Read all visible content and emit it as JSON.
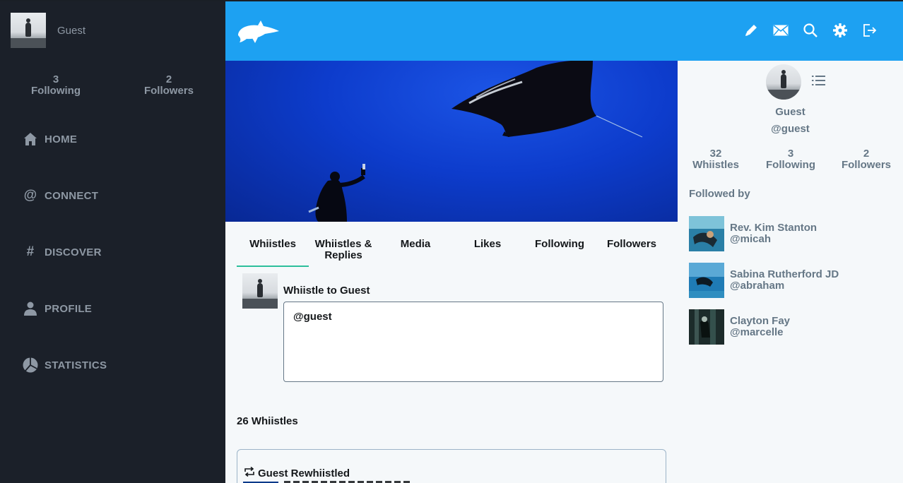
{
  "sidebar": {
    "user_name": "Guest",
    "following_count": "3",
    "following_label": "Following",
    "followers_count": "2",
    "followers_label": "Followers",
    "nav": [
      {
        "label": "HOME",
        "icon": "home-icon"
      },
      {
        "label": "CONNECT",
        "icon": "at-icon"
      },
      {
        "label": "DISCOVER",
        "icon": "hashtag-icon"
      },
      {
        "label": "PROFILE",
        "icon": "user-icon"
      },
      {
        "label": "STATISTICS",
        "icon": "pie-chart-icon"
      }
    ]
  },
  "header": {
    "logo": "whale-logo",
    "icons": [
      "pencil-icon",
      "mail-icon",
      "search-icon",
      "gear-icon",
      "logout-icon"
    ],
    "bg_color": "#1da1f2"
  },
  "tabs": [
    {
      "label": "Whiistles"
    },
    {
      "label": "Whiistles & Replies"
    },
    {
      "label": "Media"
    },
    {
      "label": "Likes"
    },
    {
      "label": "Following"
    },
    {
      "label": "Followers"
    }
  ],
  "compose": {
    "title": "Whiistle to Guest",
    "value": "@guest"
  },
  "feed": {
    "count_label": "26 Whiistles",
    "first_item_label": "Guest Rewhiistled"
  },
  "profile": {
    "name": "Guest",
    "handle": "@guest",
    "whiistles_count": "32",
    "whiistles_label": "Whiistles",
    "following_count": "3",
    "following_label": "Following",
    "followers_count": "2",
    "followers_label": "Followers",
    "followed_by_label": "Followed by",
    "followers": [
      {
        "name": "Rev. Kim Stanton",
        "handle": "@micah"
      },
      {
        "name": "Sabina Rutherford JD",
        "handle": "@abraham"
      },
      {
        "name": "Clayton Fay",
        "handle": "@marcelle"
      }
    ]
  }
}
